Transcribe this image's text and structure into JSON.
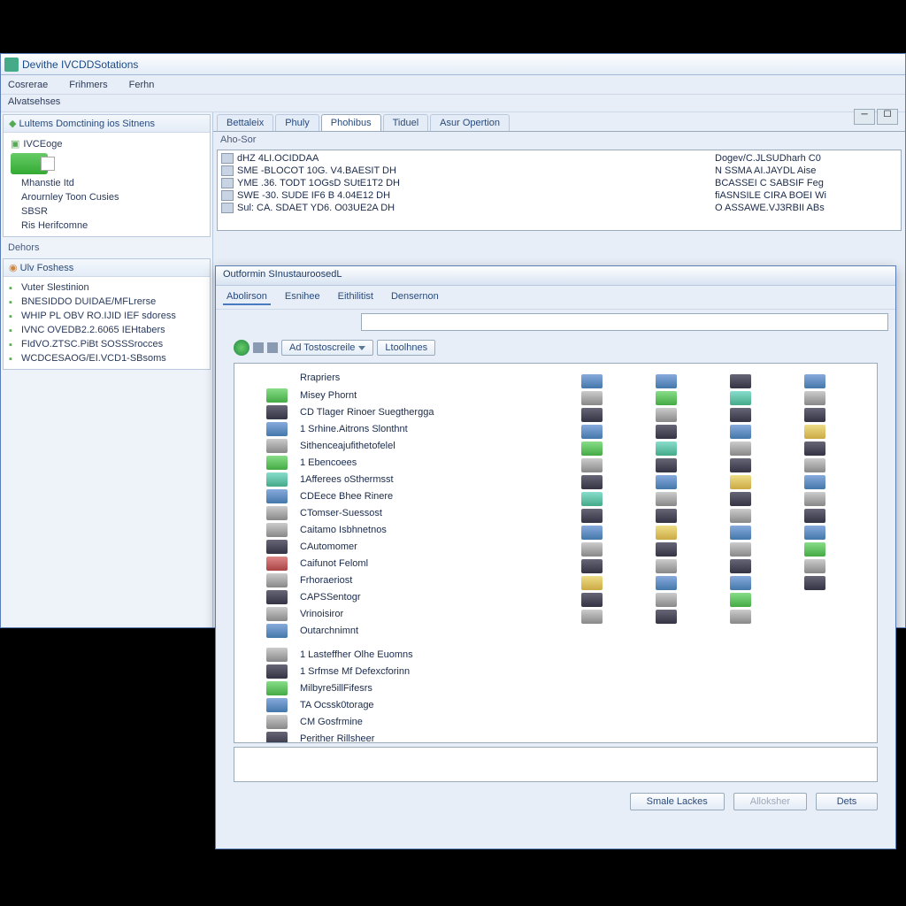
{
  "main_window": {
    "title": "Devithe IVCDDSotations",
    "menu": [
      "Cosrerae",
      "Frihmers",
      "Ferhn"
    ],
    "subtab": "Alvatsehses",
    "sidebar": {
      "panel1": {
        "header": "Lultems Domctining ios Sitnens",
        "items": [
          "IVCEoge",
          "",
          "Mhanstie Itd",
          "Arournley Toon Cusies",
          "SBSR",
          "Ris Herifcomne"
        ]
      },
      "dehors_label": "Dehors",
      "panel2": {
        "header": "Ulv Foshess",
        "items": [
          "Vuter Slestinion",
          "BNESIDDO DUIDAE/MFLrerse",
          "WHIP PL OBV RO.IJID IEF sdoress",
          "IVNC OVEDB2.2.6065 IEHtabers",
          "FIdVO.ZTSC.PiBt SOSSSrocces",
          "WCDCESAOG/EI.VCD1-SBsoms"
        ]
      }
    },
    "tabs": [
      "Bettaleix",
      "Phuly",
      "Phohibus",
      "Tiduel",
      "Asur Opertion"
    ],
    "section_label": "Aho-Sor",
    "list_left": [
      "dHZ  4LI.OCIDDAA",
      "SME -BLOCOT 10G. V4.BAESIT DH",
      "YME .36. TODT 1OGsD SUtE1T2 DH",
      "SWE  -30. SUDE IF6 B 4.04E12 DH",
      "Sul:  CA. SDAET YD6. O03UE2A DH"
    ],
    "list_right": [
      "Dogev/C.JLSUDharh C0",
      "N SSMA AI.JAYDL Aise",
      "BCASSEI C SABSIF Feg",
      "fiASNSILE CIRA BOEI Wi",
      "O ASSAWE.VJ3RBII ABs"
    ]
  },
  "dialog": {
    "title": "Outformin SInustauroosedL",
    "tabs": [
      "Abolirson",
      "Esnihee",
      "Eithilitist",
      "Densernon"
    ],
    "toolbar": {
      "add_label": "Ad Tostoscreile",
      "lib_label": "Ltoolhnes"
    },
    "categories_header": "Rrapriers",
    "categories": [
      "Misey Phornt",
      "CD Tlager Rinoer Suegthergga",
      "1 Srhine.Aitrons Slonthnt",
      "Sithenceajufithetofelel",
      "1 Ebencoees",
      "1Afferees oSthermsst",
      "CDEece Bhee Rinere",
      "CTomser-Suessost",
      "Caitamo Isbhnetnos",
      "CAutomomer",
      "Caifunot Feloml",
      "Frhoraeriost",
      "CAPSSentogr",
      "Vrinoisiror",
      "Outarchnimnt",
      "1 Lasteffher Olhe Euomns",
      "1 Srfmse Mf Defexcforinn",
      "Milbyre5illFifesrs",
      "TA Ocssk0torage",
      "CM Gosfrmine",
      "Perither Rillsheer"
    ],
    "buttons": {
      "save": "Smale Lackes",
      "middle": "Alloksher",
      "close": "Dets"
    }
  }
}
